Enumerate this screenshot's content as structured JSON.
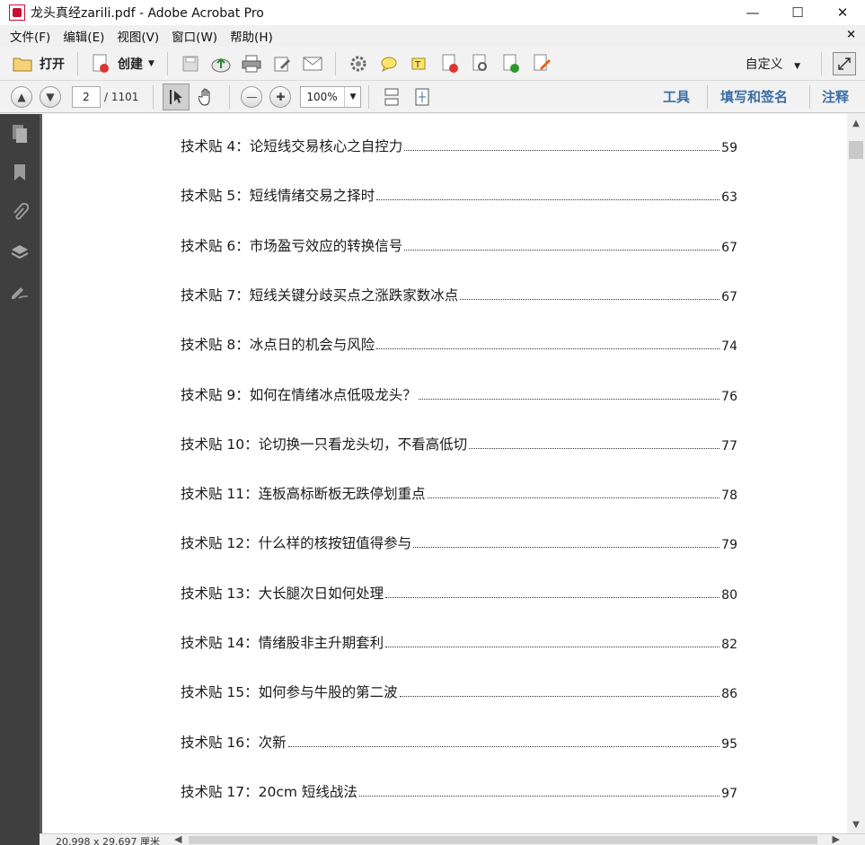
{
  "window": {
    "title": "龙头真经zarili.pdf - Adobe Acrobat Pro",
    "minimize": "—",
    "maximize": "☐",
    "close": "✕"
  },
  "menu": {
    "items": [
      "文件(F)",
      "编辑(E)",
      "视图(V)",
      "窗口(W)",
      "帮助(H)"
    ],
    "close_doc": "×"
  },
  "toolbar": {
    "open_label": "打开",
    "create_label": "创建",
    "custom_label": "自定义",
    "icons": [
      "save-icon",
      "upload-icon",
      "print-icon",
      "edit-icon",
      "email-icon",
      "settings-icon",
      "comment-icon",
      "highlight-icon",
      "pdf-icon",
      "search-doc-icon",
      "export-icon",
      "sign-icon"
    ]
  },
  "nav": {
    "current_page": "2",
    "total_pages": "/ 1101",
    "zoom": "100%",
    "tab_tools": "工具",
    "tab_fill_sign": "填写和签名",
    "tab_comment": "注释"
  },
  "toc": [
    {
      "label": "技术贴 4：论短线交易核心之自控力",
      "page": "59"
    },
    {
      "label": "技术贴 5：短线情绪交易之择时",
      "page": "63"
    },
    {
      "label": "技术贴 6：市场盈亏效应的转换信号",
      "page": "67"
    },
    {
      "label": "技术贴 7：短线关键分歧买点之涨跌家数冰点",
      "page": "67"
    },
    {
      "label": "技术贴 8：冰点日的机会与风险",
      "page": "74"
    },
    {
      "label": "技术贴 9：如何在情绪冰点低吸龙头？",
      "page": "76"
    },
    {
      "label": "技术贴 10：论切换一只看龙头切，不看高低切",
      "page": "77"
    },
    {
      "label": "技术贴 11：连板高标断板无跌停划重点",
      "page": "78"
    },
    {
      "label": "技术贴 12：什么样的核按钮值得参与",
      "page": "79"
    },
    {
      "label": "技术贴 13：大长腿次日如何处理",
      "page": "80"
    },
    {
      "label": "技术贴 14：情绪股非主升期套利",
      "page": "82"
    },
    {
      "label": "技术贴 15：如何参与牛股的第二波",
      "page": "86"
    },
    {
      "label": "技术贴 16：次新",
      "page": "95"
    },
    {
      "label": "技术贴 17：20cm 短线战法",
      "page": "97"
    }
  ],
  "status": {
    "page_size": "20.998 x 29.697 厘米"
  }
}
